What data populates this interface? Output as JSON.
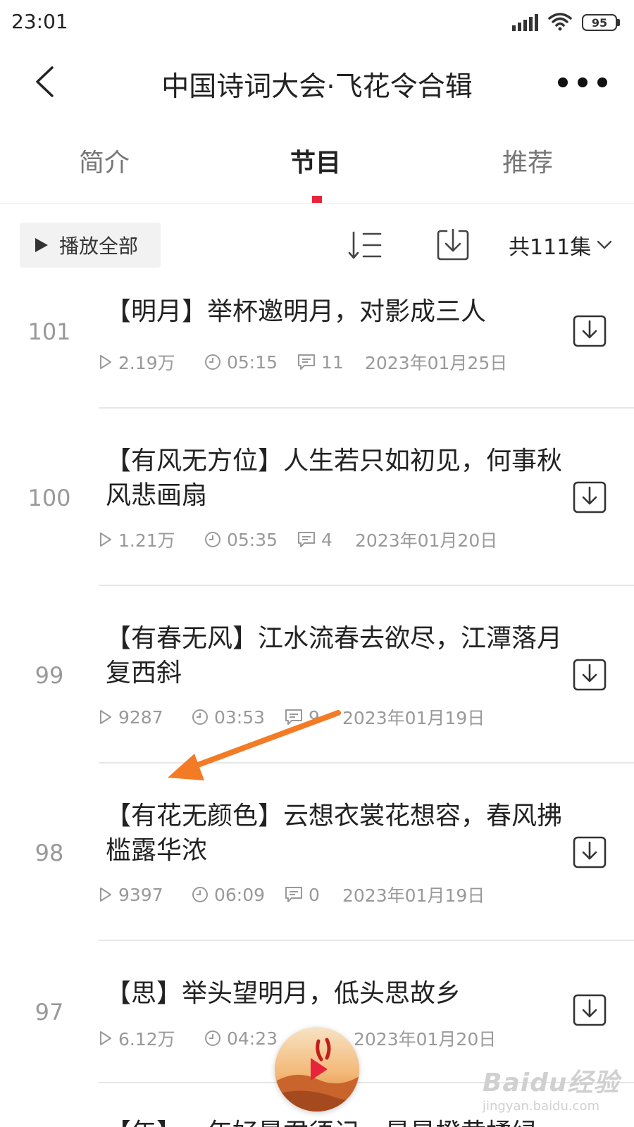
{
  "status_bar": {
    "time": "23:01",
    "battery": "95"
  },
  "header": {
    "title": "中国诗词大会·飞花令合辑"
  },
  "tabs": [
    {
      "label": "简介"
    },
    {
      "label": "节目"
    },
    {
      "label": "推荐"
    }
  ],
  "toolbar": {
    "play_all_label": "播放全部",
    "episode_count": "共111集"
  },
  "episodes": [
    {
      "number": "101",
      "title": "【明月】举杯邀明月，对影成三人",
      "plays": "2.19万",
      "duration": "05:15",
      "comments": "11",
      "date": "2023年01月25日"
    },
    {
      "number": "100",
      "title": "【有风无方位】人生若只如初见，何事秋风悲画扇",
      "plays": "1.21万",
      "duration": "05:35",
      "comments": "4",
      "date": "2023年01月20日"
    },
    {
      "number": "99",
      "title": "【有春无风】江水流春去欲尽，江潭落月复西斜",
      "plays": "9287",
      "duration": "03:53",
      "comments": "9",
      "date": "2023年01月19日"
    },
    {
      "number": "98",
      "title": "【有花无颜色】云想衣裳花想容，春风拂槛露华浓",
      "plays": "9397",
      "duration": "06:09",
      "comments": "0",
      "date": "2023年01月19日"
    },
    {
      "number": "97",
      "title": "【思】举头望明月，低头思故乡",
      "plays": "6.12万",
      "duration": "04:23",
      "comments": "",
      "date": "2023年01月20日"
    }
  ],
  "partial_next_title": "【年】一年好景君须记，最是橙黄橘绿",
  "watermark": {
    "main": "Baidu经验",
    "sub": "jingyan.baidu.com"
  },
  "colors": {
    "accent": "#e8243c",
    "arrow": "#f47b25"
  }
}
